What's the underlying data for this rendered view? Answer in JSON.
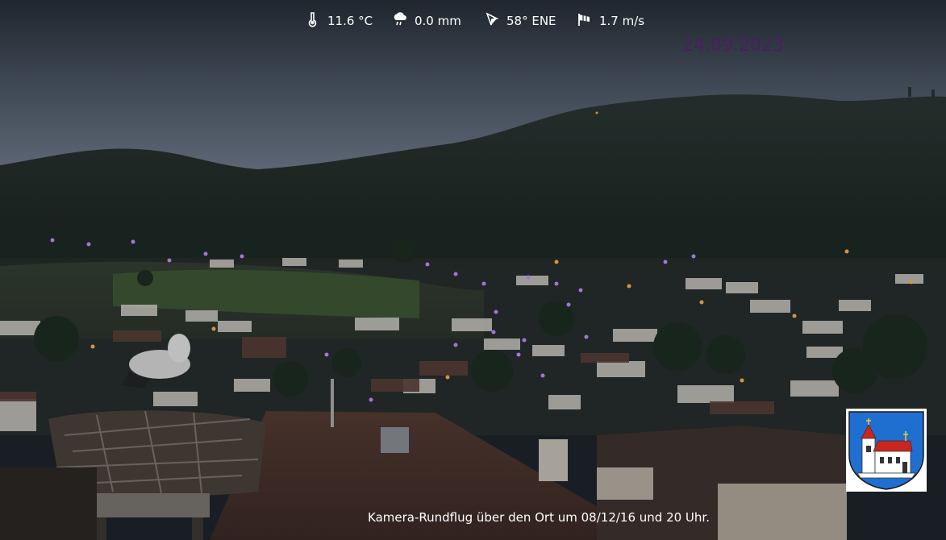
{
  "weather": {
    "temperature": "11.6 °C",
    "precipitation": "0.0 mm",
    "wind_direction": "58° ENE",
    "wind_speed": "1.7 m/s"
  },
  "date": "24.09.2023",
  "caption": "Kamera-Rundflug über den Ort um 08/12/16 und 20 Uhr.",
  "icons": {
    "temperature": "thermometer-icon",
    "precipitation": "rain-cloud-icon",
    "wind_direction": "compass-icon",
    "wind_speed": "wind-flag-icon",
    "crest": "coat-of-arms"
  },
  "colors": {
    "sky_top": "#2d3440",
    "sky_horizon": "#6e7a88",
    "forest": "#1f2a22",
    "meadow": "#3c5a2e",
    "roof": "#4a3028",
    "date_text": "#4a1f5e",
    "crest_blue": "#1f6fd0",
    "crest_red": "#c8261f"
  }
}
